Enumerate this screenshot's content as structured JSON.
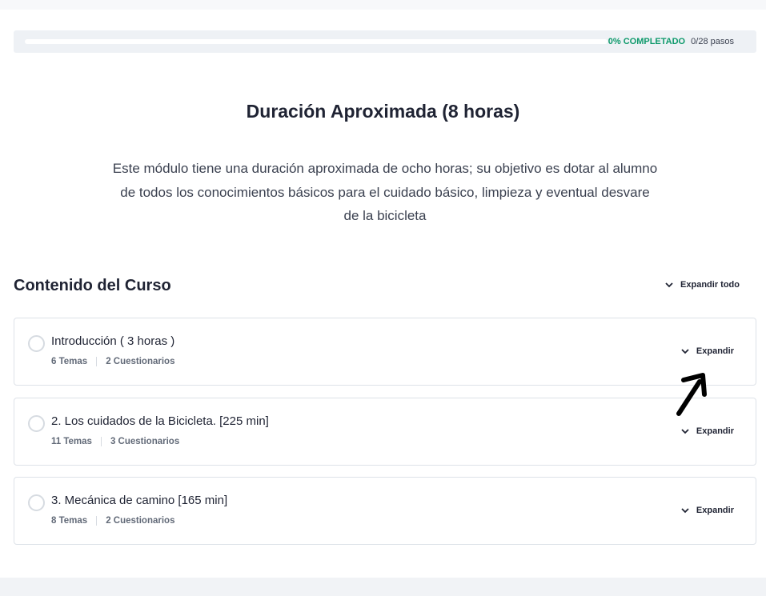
{
  "progress": {
    "percent_label": "0% COMPLETADO",
    "steps_label": "0/28 pasos",
    "fraction": 0
  },
  "module": {
    "title": "Duración Aproximada (8 horas)",
    "description": "Este módulo tiene una duración aproximada de ocho horas; su objetivo es dotar al alumno de todos los conocimientos básicos para el cuidado básico, limpieza y eventual desvare de la bicicleta"
  },
  "content": {
    "section_title": "Contenido del Curso",
    "expand_all_label": "Expandir todo",
    "lessons": [
      {
        "title": "Introducción ( 3 horas )",
        "topics": "6 Temas",
        "quizzes": "2 Cuestionarios",
        "expand_label": "Expandir"
      },
      {
        "title": "2. Los cuidados de la Bicicleta. [225 min]",
        "topics": "11 Temas",
        "quizzes": "3 Cuestionarios",
        "expand_label": "Expandir"
      },
      {
        "title": "3. Mecánica de camino [165 min]",
        "topics": "8 Temas",
        "quizzes": "2 Cuestionarios",
        "expand_label": "Expandir"
      }
    ]
  },
  "colors": {
    "accent": "#0f9a6c",
    "text": "#1f2333",
    "muted": "#626a78",
    "border": "#dde2e8"
  },
  "icons": {
    "chevron": "chevron-down-icon",
    "status": "circle-status-icon",
    "annotation": "arrow-annotation-icon"
  }
}
